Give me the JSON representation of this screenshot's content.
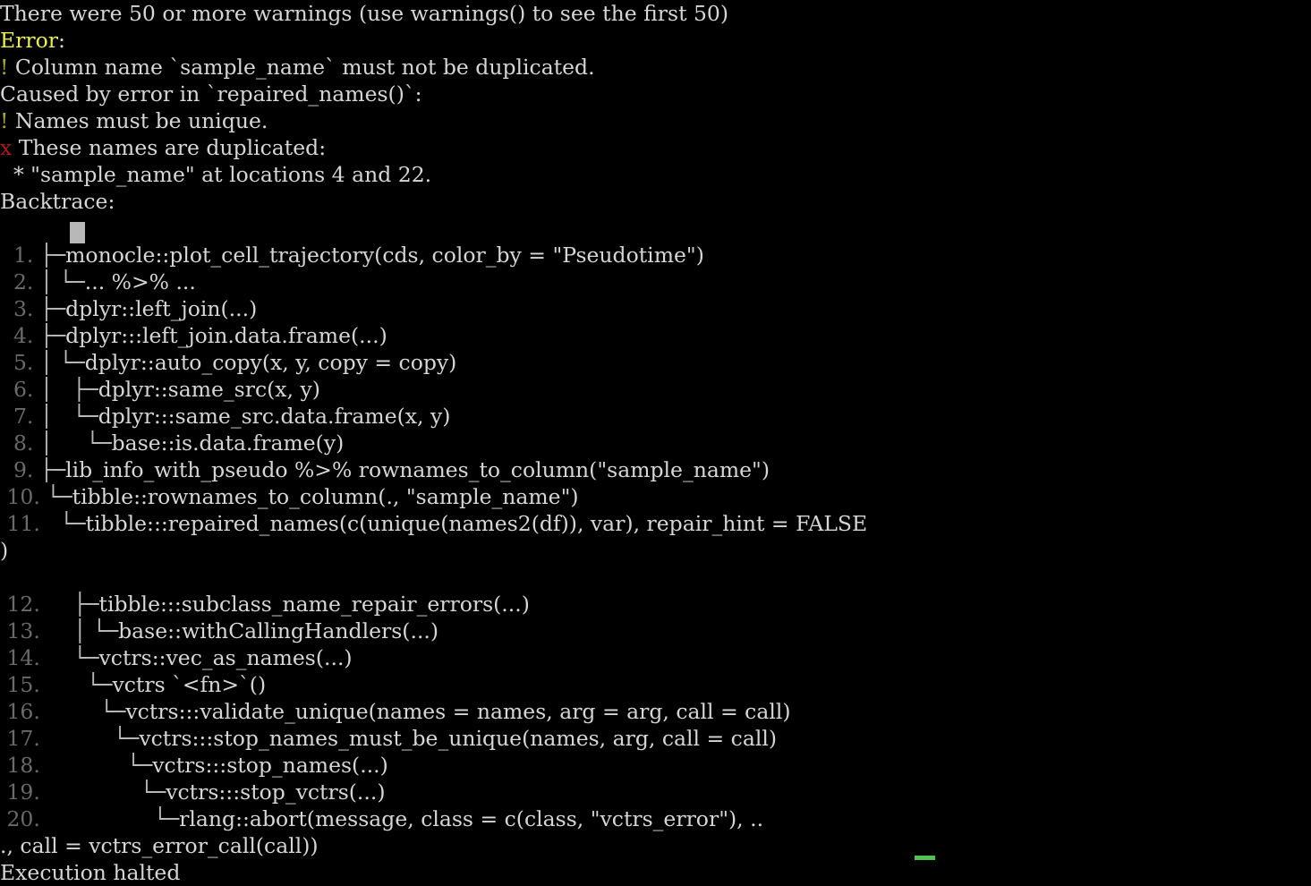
{
  "terminal": {
    "title": "R session error output",
    "background_color": "#000000",
    "foreground_color": "#d6d6d6",
    "accent_colors": {
      "error_yellow": "#eeee44",
      "bullet_yellow": "#a8a832",
      "cross_red": "#b01818",
      "line_number_gray": "#6a6a6a",
      "tree_gray": "#b9b9b9",
      "cursor_gray": "#b8b8b8",
      "prompt_green": "#4fc24f"
    },
    "lines": [
      {
        "id": "warnings-notice",
        "segments": [
          {
            "text": "There were 50 or more warnings (use warnings() to see the first 50)",
            "color": "white"
          }
        ]
      },
      {
        "id": "error-header",
        "segments": [
          {
            "text": "Error",
            "color": "yellow"
          },
          {
            "text": ":",
            "color": "white"
          }
        ]
      },
      {
        "id": "error-bullet-1",
        "segments": [
          {
            "text": "!",
            "color": "dimyellow"
          },
          {
            "text": " Column name `sample_name` must not be duplicated.",
            "color": "white"
          }
        ]
      },
      {
        "id": "caused-by",
        "segments": [
          {
            "text": "Caused by error in `repaired_names()`:",
            "color": "white"
          }
        ]
      },
      {
        "id": "error-bullet-2",
        "segments": [
          {
            "text": "!",
            "color": "dimyellow"
          },
          {
            "text": " Names must be unique.",
            "color": "white"
          }
        ]
      },
      {
        "id": "error-cross",
        "segments": [
          {
            "text": "x",
            "color": "red"
          },
          {
            "text": " These names are duplicated:",
            "color": "white"
          }
        ]
      },
      {
        "id": "duplicate-detail",
        "segments": [
          {
            "text": "  * \"sample_name\" at locations 4 and 22.",
            "color": "white"
          }
        ]
      },
      {
        "id": "backtrace-header",
        "segments": [
          {
            "text": "Backtrace:",
            "color": "white"
          }
        ]
      },
      {
        "id": "backtrace-spacer",
        "segments": [
          {
            "text": "",
            "color": "white"
          }
        ]
      },
      {
        "id": "frame-1",
        "segments": [
          {
            "text": "  1. ",
            "color": "gray"
          },
          {
            "text": "├─",
            "color": "tree"
          },
          {
            "text": "monocle::plot_cell_trajectory(cds, color_by = \"Pseudotime\")",
            "color": "white"
          }
        ]
      },
      {
        "id": "frame-2",
        "segments": [
          {
            "text": "  2. ",
            "color": "gray"
          },
          {
            "text": "│ └─",
            "color": "tree"
          },
          {
            "text": "... %>% ...",
            "color": "white"
          }
        ]
      },
      {
        "id": "frame-3",
        "segments": [
          {
            "text": "  3. ",
            "color": "gray"
          },
          {
            "text": "├─",
            "color": "tree"
          },
          {
            "text": "dplyr::left_join(...)",
            "color": "white"
          }
        ]
      },
      {
        "id": "frame-4",
        "segments": [
          {
            "text": "  4. ",
            "color": "gray"
          },
          {
            "text": "├─",
            "color": "tree"
          },
          {
            "text": "dplyr:::left_join.data.frame(...)",
            "color": "white"
          }
        ]
      },
      {
        "id": "frame-5",
        "segments": [
          {
            "text": "  5. ",
            "color": "gray"
          },
          {
            "text": "│ └─",
            "color": "tree"
          },
          {
            "text": "dplyr::auto_copy(x, y, copy = copy)",
            "color": "white"
          }
        ]
      },
      {
        "id": "frame-6",
        "segments": [
          {
            "text": "  6. ",
            "color": "gray"
          },
          {
            "text": "│   ├─",
            "color": "tree"
          },
          {
            "text": "dplyr::same_src(x, y)",
            "color": "white"
          }
        ]
      },
      {
        "id": "frame-7",
        "segments": [
          {
            "text": "  7. ",
            "color": "gray"
          },
          {
            "text": "│   └─",
            "color": "tree"
          },
          {
            "text": "dplyr:::same_src.data.frame(x, y)",
            "color": "white"
          }
        ]
      },
      {
        "id": "frame-8",
        "segments": [
          {
            "text": "  8. ",
            "color": "gray"
          },
          {
            "text": "│     └─",
            "color": "tree"
          },
          {
            "text": "base::is.data.frame(y)",
            "color": "white"
          }
        ]
      },
      {
        "id": "frame-9",
        "segments": [
          {
            "text": "  9. ",
            "color": "gray"
          },
          {
            "text": "├─",
            "color": "tree"
          },
          {
            "text": "lib_info_with_pseudo %>% rownames_to_column(\"sample_name\")",
            "color": "white"
          }
        ]
      },
      {
        "id": "frame-10",
        "segments": [
          {
            "text": " 10. ",
            "color": "gray"
          },
          {
            "text": "└─",
            "color": "tree"
          },
          {
            "text": "tibble::rownames_to_column(., \"sample_name\")",
            "color": "white"
          }
        ]
      },
      {
        "id": "frame-11",
        "segments": [
          {
            "text": " 11. ",
            "color": "gray"
          },
          {
            "text": "  └─",
            "color": "tree"
          },
          {
            "text": "tibble:::repaired_names(c(unique(names2(df)), var), repair_hint = FALSE",
            "color": "white"
          }
        ]
      },
      {
        "id": "frame-11-wrap",
        "segments": [
          {
            "text": ")",
            "color": "white"
          }
        ]
      },
      {
        "id": "frame-11-spacer",
        "segments": [
          {
            "text": "",
            "color": "white"
          }
        ]
      },
      {
        "id": "frame-12",
        "segments": [
          {
            "text": " 12. ",
            "color": "gray"
          },
          {
            "text": "    ├─",
            "color": "tree"
          },
          {
            "text": "tibble:::subclass_name_repair_errors(...)",
            "color": "white"
          }
        ]
      },
      {
        "id": "frame-13",
        "segments": [
          {
            "text": " 13. ",
            "color": "gray"
          },
          {
            "text": "    │ └─",
            "color": "tree"
          },
          {
            "text": "base::withCallingHandlers(...)",
            "color": "white"
          }
        ]
      },
      {
        "id": "frame-14",
        "segments": [
          {
            "text": " 14. ",
            "color": "gray"
          },
          {
            "text": "    └─",
            "color": "tree"
          },
          {
            "text": "vctrs::vec_as_names(...)",
            "color": "white"
          }
        ]
      },
      {
        "id": "frame-15",
        "segments": [
          {
            "text": " 15. ",
            "color": "gray"
          },
          {
            "text": "      └─",
            "color": "tree"
          },
          {
            "text": "vctrs `<fn>`()",
            "color": "white"
          }
        ]
      },
      {
        "id": "frame-16",
        "segments": [
          {
            "text": " 16. ",
            "color": "gray"
          },
          {
            "text": "        └─",
            "color": "tree"
          },
          {
            "text": "vctrs:::validate_unique(names = names, arg = arg, call = call)",
            "color": "white"
          }
        ]
      },
      {
        "id": "frame-17",
        "segments": [
          {
            "text": " 17. ",
            "color": "gray"
          },
          {
            "text": "          └─",
            "color": "tree"
          },
          {
            "text": "vctrs:::stop_names_must_be_unique(names, arg, call = call)",
            "color": "white"
          }
        ]
      },
      {
        "id": "frame-18",
        "segments": [
          {
            "text": " 18. ",
            "color": "gray"
          },
          {
            "text": "            └─",
            "color": "tree"
          },
          {
            "text": "vctrs:::stop_names(...)",
            "color": "white"
          }
        ]
      },
      {
        "id": "frame-19",
        "segments": [
          {
            "text": " 19. ",
            "color": "gray"
          },
          {
            "text": "              └─",
            "color": "tree"
          },
          {
            "text": "vctrs:::stop_vctrs(...)",
            "color": "white"
          }
        ]
      },
      {
        "id": "frame-20",
        "segments": [
          {
            "text": " 20. ",
            "color": "gray"
          },
          {
            "text": "                └─",
            "color": "tree"
          },
          {
            "text": "rlang::abort(message, class = c(class, \"vctrs_error\"), ..",
            "color": "white"
          }
        ]
      },
      {
        "id": "frame-20-wrap",
        "segments": [
          {
            "text": "., call = vctrs_error_call(call))",
            "color": "white"
          }
        ]
      },
      {
        "id": "execution-halted",
        "segments": [
          {
            "text": "Execution halted",
            "color": "white"
          }
        ]
      }
    ],
    "cursor": {
      "backtrace_block_label": "text-cursor-block",
      "prompt_underscore_label": "prompt-cursor"
    }
  }
}
